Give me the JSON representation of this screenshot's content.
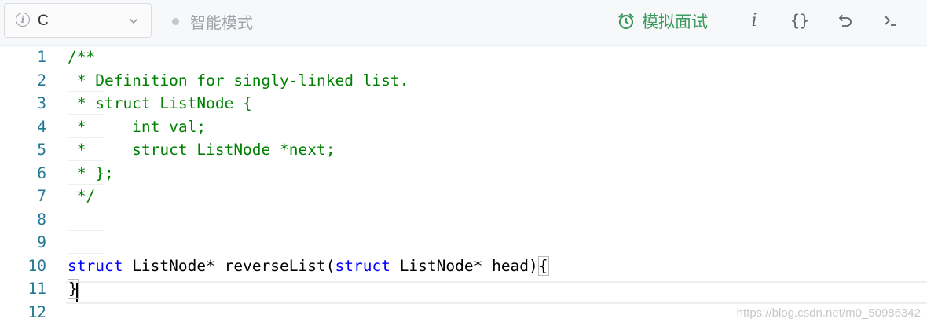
{
  "toolbar": {
    "language": "C",
    "mode_label": "智能模式",
    "interview_label": "模拟面试",
    "icons": [
      "info-icon",
      "chevron-down-icon",
      "alarm-clock-icon",
      "info-italic-icon",
      "braces-icon",
      "reset-icon",
      "terminal-icon"
    ],
    "colors": {
      "accent_green": "#3c9a5f",
      "muted": "#a0a5ab"
    }
  },
  "editor": {
    "lines": [
      {
        "n": "1",
        "parts": [
          {
            "t": "/**",
            "c": "cmt"
          }
        ]
      },
      {
        "n": "2",
        "parts": [
          {
            "t": " * Definition for singly-linked list.",
            "c": "cmt"
          }
        ]
      },
      {
        "n": "3",
        "parts": [
          {
            "t": " * struct ListNode {",
            "c": "cmt"
          }
        ]
      },
      {
        "n": "4",
        "parts": [
          {
            "t": " *     int val;",
            "c": "cmt"
          }
        ]
      },
      {
        "n": "5",
        "parts": [
          {
            "t": " *     struct ListNode *next;",
            "c": "cmt"
          }
        ]
      },
      {
        "n": "6",
        "parts": [
          {
            "t": " * };",
            "c": "cmt"
          }
        ]
      },
      {
        "n": "7",
        "parts": [
          {
            "t": " */",
            "c": "cmt"
          }
        ]
      },
      {
        "n": "8",
        "parts": []
      },
      {
        "n": "9",
        "parts": []
      },
      {
        "n": "10",
        "parts": [
          {
            "t": "struct",
            "c": "kw"
          },
          {
            "t": " ListNode* reverseList(",
            "c": ""
          },
          {
            "t": "struct",
            "c": "kw"
          },
          {
            "t": " ListNode* head)",
            "c": ""
          },
          {
            "t": "{",
            "c": "bracket"
          }
        ]
      },
      {
        "n": "11",
        "parts": [
          {
            "t": "}",
            "c": "bracket"
          }
        ]
      },
      {
        "n": "12",
        "parts": []
      }
    ],
    "colors": {
      "comment": "#008000",
      "keyword": "#0000ff",
      "line_number": "#237893"
    }
  },
  "watermark": "https://blog.csdn.net/m0_50986342"
}
